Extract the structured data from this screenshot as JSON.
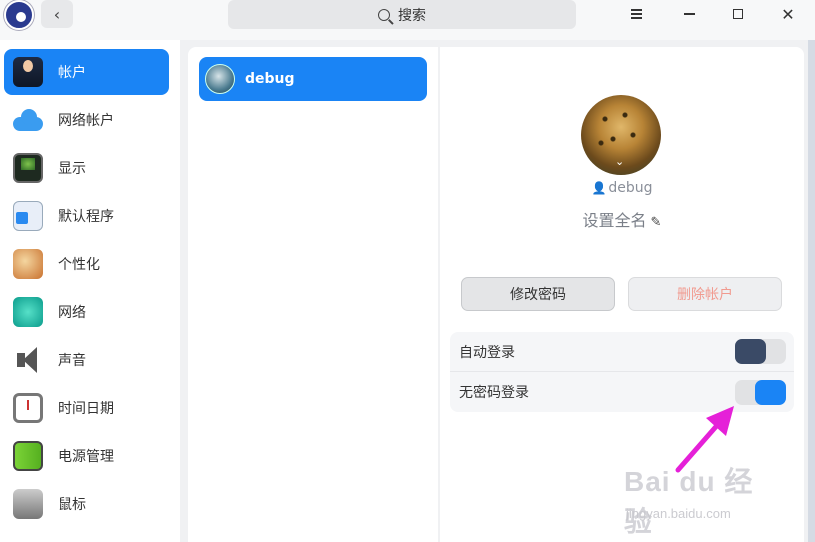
{
  "titlebar": {
    "search_label": "搜索",
    "back_glyph": "‹",
    "close_glyph": "✕"
  },
  "sidebar": {
    "items": [
      {
        "label": "帐户",
        "icon": "account-icon",
        "active": true
      },
      {
        "label": "网络帐户",
        "icon": "cloud-icon"
      },
      {
        "label": "显示",
        "icon": "display-icon"
      },
      {
        "label": "默认程序",
        "icon": "default-apps-icon"
      },
      {
        "label": "个性化",
        "icon": "personalization-icon"
      },
      {
        "label": "网络",
        "icon": "network-icon"
      },
      {
        "label": "声音",
        "icon": "sound-icon"
      },
      {
        "label": "时间日期",
        "icon": "clock-icon"
      },
      {
        "label": "电源管理",
        "icon": "battery-icon"
      },
      {
        "label": "鼠标",
        "icon": "mouse-icon"
      }
    ]
  },
  "users": [
    {
      "name": "debug",
      "selected": true
    }
  ],
  "detail": {
    "username": "debug",
    "fullname_placeholder": "设置全名",
    "change_password_label": "修改密码",
    "delete_account_label": "删除帐户",
    "settings": [
      {
        "label": "自动登录",
        "enabled": false
      },
      {
        "label": "无密码登录",
        "enabled": true
      }
    ]
  },
  "watermark": {
    "brand": "Bai du 经验",
    "url": "jingyan.baidu.com"
  },
  "colors": {
    "accent": "#1a84f5",
    "arrow": "#e520d8",
    "delete_text": "#f19a8f"
  }
}
